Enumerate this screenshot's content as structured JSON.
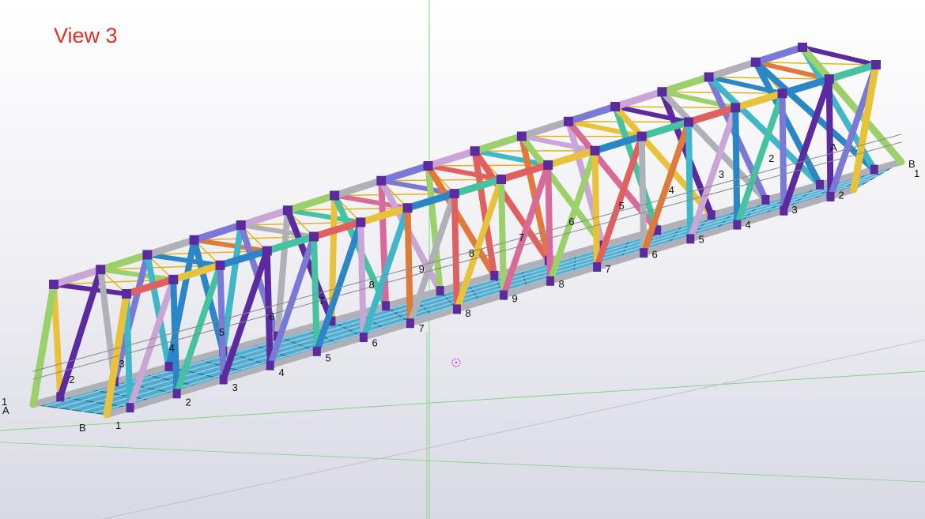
{
  "viewport": {
    "title": "View 3",
    "colors": {
      "title": "#e0302a",
      "background_top": "#ffffff",
      "background_bottom": "#d9d9e4",
      "grid_line": "#7ed67e",
      "deck": "#3aa0c8",
      "gusset": "#5a2a9e",
      "bracing": "#e3b21b",
      "cursor": "#d23fd2"
    },
    "member_palette": [
      "#e06060",
      "#3fb7c9",
      "#c9a6d6",
      "#e8c23a",
      "#5a2a9e",
      "#9bd06a",
      "#2a86c4",
      "#e07a3c",
      "#b0b0b8",
      "#45c3a0",
      "#d86a9a",
      "#7a7ad6"
    ],
    "grid_labels": {
      "left_corner": [
        "1",
        "A",
        "B",
        "1"
      ],
      "right_corner": [
        "A",
        "B",
        "1"
      ],
      "front_bottom": [
        "2",
        "3",
        "4",
        "5",
        "6",
        "7",
        "8",
        "9",
        "8",
        "7",
        "6",
        "5",
        "4",
        "3",
        "2"
      ],
      "back_bottom": [
        "1",
        "2",
        "3",
        "4",
        "5",
        "6",
        "7",
        "8",
        "9",
        "8",
        "7",
        "6",
        "5",
        "4",
        "3",
        "2",
        "1"
      ],
      "deck": [
        "2",
        "3",
        "4",
        "5",
        "6",
        "7",
        "8",
        "9",
        "8",
        "7",
        "6",
        "5",
        "4",
        "3",
        "2"
      ]
    }
  }
}
